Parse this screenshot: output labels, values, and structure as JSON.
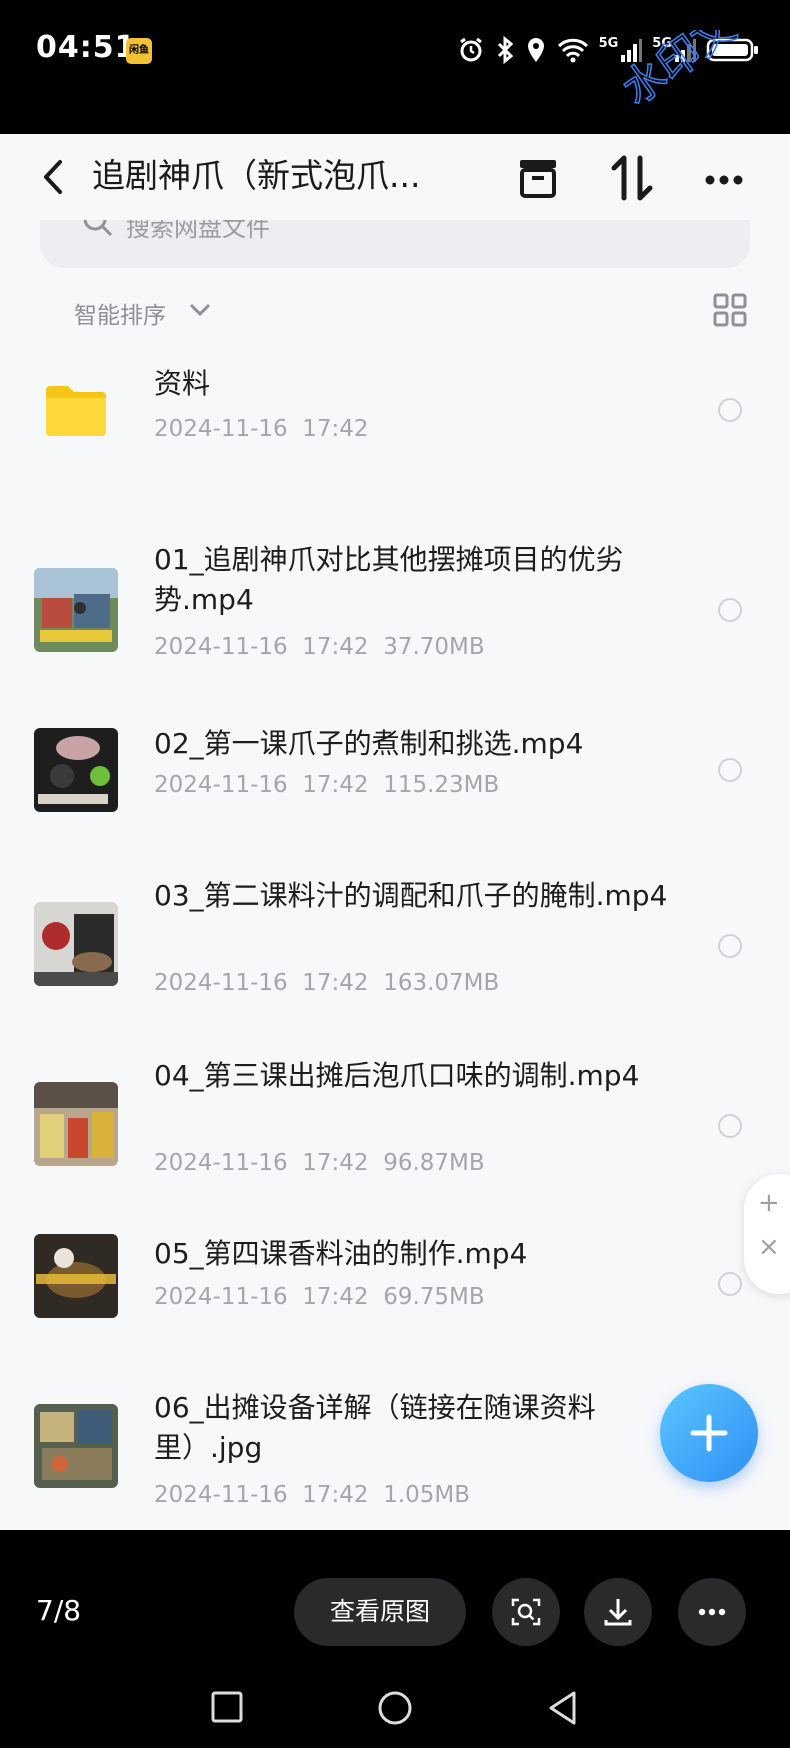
{
  "status": {
    "time": "04:51",
    "notif_label": "闲鱼",
    "network_1": "5G",
    "network_2": "5G"
  },
  "watermark": "水印文字",
  "header": {
    "title": "追剧神爪（新式泡爪...",
    "back_icon": "chevron-left-icon",
    "actions": [
      "archive-icon",
      "sort-updown-icon",
      "more-horizontal-icon"
    ]
  },
  "search": {
    "placeholder": "搜索网盘文件"
  },
  "sort": {
    "label": "智能排序",
    "view_icon": "grid-view-icon"
  },
  "files": [
    {
      "name": "资料",
      "date": "2024-11-16  17:42",
      "size": "",
      "type": "folder"
    },
    {
      "name": "01_追剧神爪对比其他摆摊项目的优劣势.mp4",
      "date": "2024-11-16  17:42",
      "size": "37.70MB",
      "type": "video"
    },
    {
      "name": "02_第一课爪子的煮制和挑选.mp4",
      "date": "2024-11-16  17:42",
      "size": "115.23MB",
      "type": "video"
    },
    {
      "name": "03_第二课料汁的调配和爪子的腌制.mp4",
      "date": "2024-11-16  17:42",
      "size": "163.07MB",
      "type": "video"
    },
    {
      "name": "04_第三课出摊后泡爪口味的调制.mp4",
      "date": "2024-11-16  17:42",
      "size": "96.87MB",
      "type": "video"
    },
    {
      "name": "05_第四课香料油的制作.mp4",
      "date": "2024-11-16  17:42",
      "size": "69.75MB",
      "type": "video"
    },
    {
      "name": "06_出摊设备详解（链接在随课资料里）.jpg",
      "date": "2024-11-16  17:42",
      "size": "1.05MB",
      "type": "image"
    }
  ],
  "file_meta": [
    "2024-11-16  17:42",
    "2024-11-16  17:42  37.70MB",
    "2024-11-16  17:42  115.23MB",
    "2024-11-16  17:42  163.07MB",
    "2024-11-16  17:42  96.87MB",
    "2024-11-16  17:42  69.75MB",
    "2024-11-16  17:42  1.05MB"
  ],
  "side_float": {
    "plus": "+",
    "close": "×"
  },
  "viewer": {
    "page_count": "7/8",
    "view_original": "查看原图",
    "buttons": [
      "scan-icon",
      "download-icon",
      "more-horizontal-icon"
    ]
  },
  "colors": {
    "accent": "#2f8ef5",
    "background": "#f7f8fa",
    "text_primary": "#1d1d1f",
    "text_secondary": "#a4a6ab"
  }
}
